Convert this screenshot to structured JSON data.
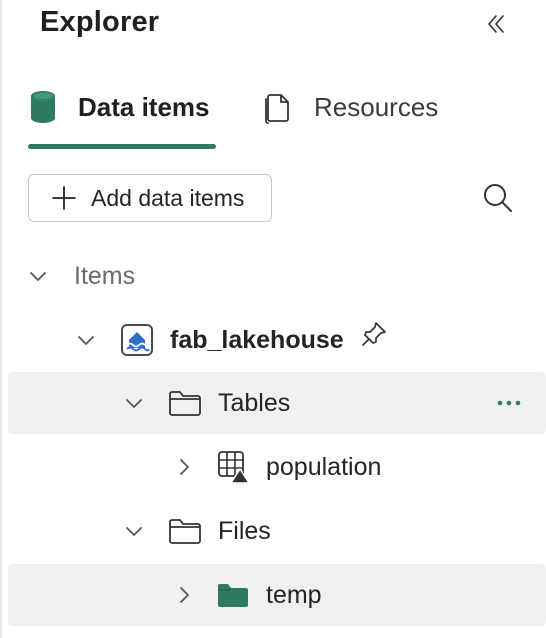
{
  "explorer": {
    "title": "Explorer",
    "collapse_icon": "double-chevron-left-icon"
  },
  "tabs": [
    {
      "label": "Data items",
      "icon": "database-icon",
      "active": true
    },
    {
      "label": "Resources",
      "icon": "document-icon",
      "active": false
    }
  ],
  "toolbar": {
    "add_label": "Add data items",
    "search_icon": "search-icon"
  },
  "tree": {
    "section_label": "Items",
    "lakehouse": {
      "label": "fab_lakehouse",
      "icon": "lakehouse-icon",
      "pinned": true
    },
    "tables": {
      "label": "Tables",
      "icon": "folder-icon"
    },
    "population": {
      "label": "population",
      "icon": "table-icon"
    },
    "files": {
      "label": "Files",
      "icon": "folder-icon"
    },
    "temp": {
      "label": "temp",
      "icon": "folder-filled-icon"
    }
  },
  "colors": {
    "accent": "#2f7a63",
    "selected_row": "#f0f0f0",
    "section_text": "#6b6b6b"
  }
}
